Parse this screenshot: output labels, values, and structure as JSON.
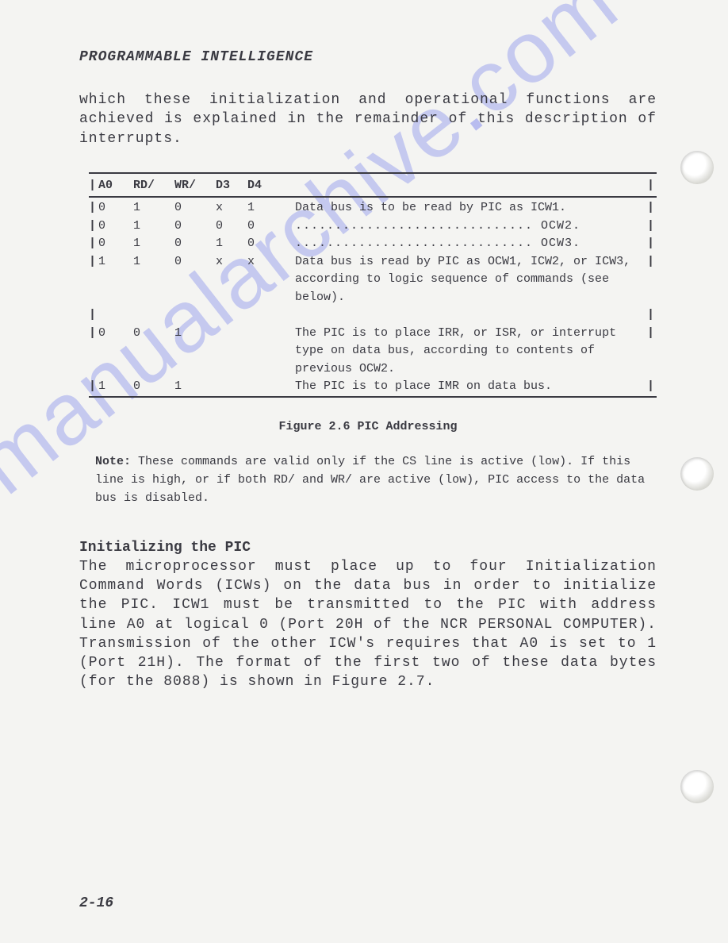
{
  "header": "PROGRAMMABLE INTELLIGENCE",
  "intro": "which these initialization and operational functions are achieved is explained in the remainder of this description of interrupts.",
  "table": {
    "headers": {
      "c1": "A0",
      "c2": "RD/",
      "c3": "WR/",
      "c4": "D3",
      "c5": "D4"
    },
    "rows": [
      {
        "a0": "0",
        "rd": "1",
        "wr": "0",
        "d3": "x",
        "d4": "1",
        "desc": "Data bus is to be read by PIC as ICW1."
      },
      {
        "a0": "0",
        "rd": "1",
        "wr": "0",
        "d3": "0",
        "d4": "0",
        "desc": ".............................. OCW2."
      },
      {
        "a0": "0",
        "rd": "1",
        "wr": "0",
        "d3": "1",
        "d4": "0",
        "desc": ".............................. OCW3."
      },
      {
        "a0": "1",
        "rd": "1",
        "wr": "0",
        "d3": "x",
        "d4": "x",
        "desc": "Data bus is read by PIC as OCW1, ICW2, or ICW3, according to logic sequence of commands (see below)."
      },
      {
        "a0": "0",
        "rd": "0",
        "wr": "1",
        "d3": "",
        "d4": "",
        "desc": "The PIC is to place IRR, or ISR, or interrupt type on data bus, according to contents of previous OCW2."
      },
      {
        "a0": "1",
        "rd": "0",
        "wr": "1",
        "d3": "",
        "d4": "",
        "desc": "The PIC is to place IMR on data bus."
      }
    ]
  },
  "figure_caption": "Figure 2.6  PIC Addressing",
  "note_label": "Note:",
  "note_text": "These  commands are valid only if the CS line  is  active (low).  If this line is high,  or if both RD/ and WR/ are active (low), PIC access to the data bus is disabled.",
  "section_head": "Initializing the PIC",
  "body": "The  microprocessor  must  place  up  to  four Initialization Command Words (ICWs)  on the data bus in order to initialize the PIC. ICW1 must be transmitted to the PIC with address line A0 at logical 0 (Port 20H of the NCR PERSONAL COMPUTER). Transmission of the other ICW's requires that A0 is set to 1 (Port 21H). The format of the first two of these data bytes (for the 8088) is shown in Figure 2.7.",
  "page_number": "2-16",
  "watermark": "manualarchive.com"
}
